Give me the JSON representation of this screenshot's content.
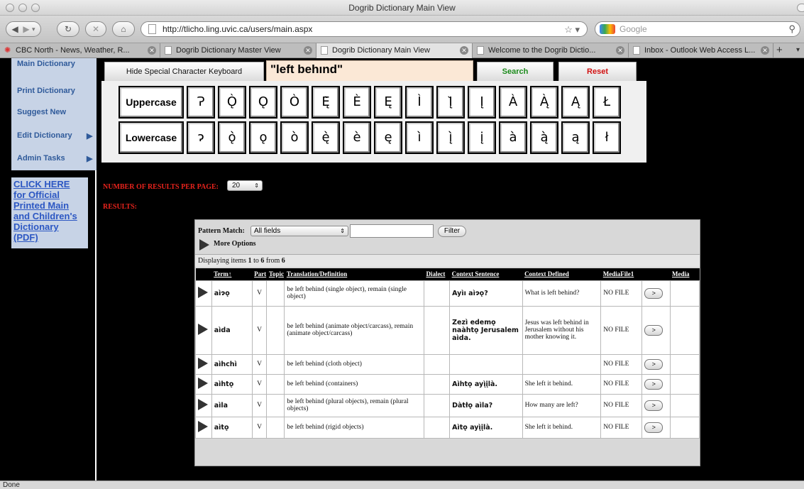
{
  "window": {
    "title": "Dogrib Dictionary Main View"
  },
  "toolbar": {
    "url": "http://tlicho.ling.uvic.ca/users/main.aspx",
    "search_placeholder": "Google"
  },
  "tabs": [
    {
      "label": "CBC North - News, Weather, R..."
    },
    {
      "label": "Dogrib Dictionary Master View"
    },
    {
      "label": "Dogrib Dictionary Main View"
    },
    {
      "label": "Welcome to the Dogrib Dictio..."
    },
    {
      "label": "Inbox - Outlook Web Access L..."
    }
  ],
  "sidebar": {
    "items": [
      {
        "label": "Main Dictionary"
      },
      {
        "label": "Print Dictionary"
      },
      {
        "label": "Suggest New"
      },
      {
        "label": "Edit Dictionary"
      },
      {
        "label": "Admin Tasks"
      }
    ],
    "pdf_lines": [
      "CLICK HERE",
      "for Official",
      "Printed Main",
      "and Children's",
      "Dictionary",
      "(PDF)"
    ]
  },
  "keyboard": {
    "hide_label": "Hide Special Character Keyboard",
    "search_value": "\"left behınd\"",
    "search_label": "Search",
    "reset_label": "Reset",
    "upper_label": "Uppercase",
    "lower_label": "Lowercase",
    "upper": [
      "Ɂ",
      "Ǫ̀",
      "Ǫ",
      "Ò",
      "Ę̀",
      "È",
      "Ę",
      "Ì",
      "Į̀",
      "Į",
      "À",
      "Ą̀",
      "Ą",
      "Ł"
    ],
    "lower": [
      "ɂ",
      "ǫ̀",
      "ǫ",
      "ò",
      "ę̀",
      "è",
      "ę",
      "ì",
      "į̀",
      "į",
      "à",
      "ą̀",
      "ą",
      "ł"
    ]
  },
  "results": {
    "per_page_label": "NUMBER OF RESULTS PER PAGE:",
    "per_page_value": "20",
    "results_label": "RESULTS:",
    "pattern_label": "Pattern Match:",
    "pattern_value": "All fields",
    "filter_label": "Filter",
    "more_options": "More Options",
    "display_prefix": "Displaying items ",
    "display_from": "1",
    "display_to_word": " to ",
    "display_to": "6",
    "display_of_word": " from ",
    "display_total": "6",
    "columns": [
      "Term↑",
      "Part",
      "Topic",
      "Translation/Definition",
      "Dialect",
      "Context Sentence",
      "Context Defined",
      "MediaFile1",
      "",
      "Media"
    ],
    "rows": [
      {
        "term": "aìɂǫ",
        "part": "V",
        "topic": "",
        "def": "be left behind (single object), remain (single object)",
        "dialect": "",
        "ctx": "Ayìı aìɂǫ?",
        "ctxdef": "What is left behind?",
        "media": "NO FILE",
        "btn": ">"
      },
      {
        "term": "aìda",
        "part": "V",
        "topic": "",
        "def": "be left behind (animate object/carcass), remain (animate object/carcass)",
        "dialect": "",
        "ctx": "Zezì edemǫ naàhtǫ Jerusalem aìda.",
        "ctxdef": "Jesus was left behind in Jerusalem without his mother knowing it.",
        "media": "NO FILE",
        "btn": ">"
      },
      {
        "term": "aìhchì",
        "part": "V",
        "topic": "",
        "def": "be left behind (cloth object)",
        "dialect": "",
        "ctx": "",
        "ctxdef": "",
        "media": "NO FILE",
        "btn": ">"
      },
      {
        "term": "aìhtǫ",
        "part": "V",
        "topic": "",
        "def": "be left behind (containers)",
        "dialect": "",
        "ctx": "Aìhtǫ ayį̀įlà.",
        "ctxdef": "She left it behind.",
        "media": "NO FILE",
        "btn": ">"
      },
      {
        "term": "aìla",
        "part": "V",
        "topic": "",
        "def": "be left behind (plural objects), remain (plural objects)",
        "dialect": "",
        "ctx": "Dàtłǫ aìla?",
        "ctxdef": "How many are left?",
        "media": "NO FILE",
        "btn": ">"
      },
      {
        "term": "aìtǫ",
        "part": "V",
        "topic": "",
        "def": "be left behind (rigid objects)",
        "dialect": "",
        "ctx": "Aìtǫ ayį̀įlà.",
        "ctxdef": "She left it behind.",
        "media": "NO FILE",
        "btn": ">"
      }
    ]
  },
  "status": {
    "text": "Done"
  }
}
